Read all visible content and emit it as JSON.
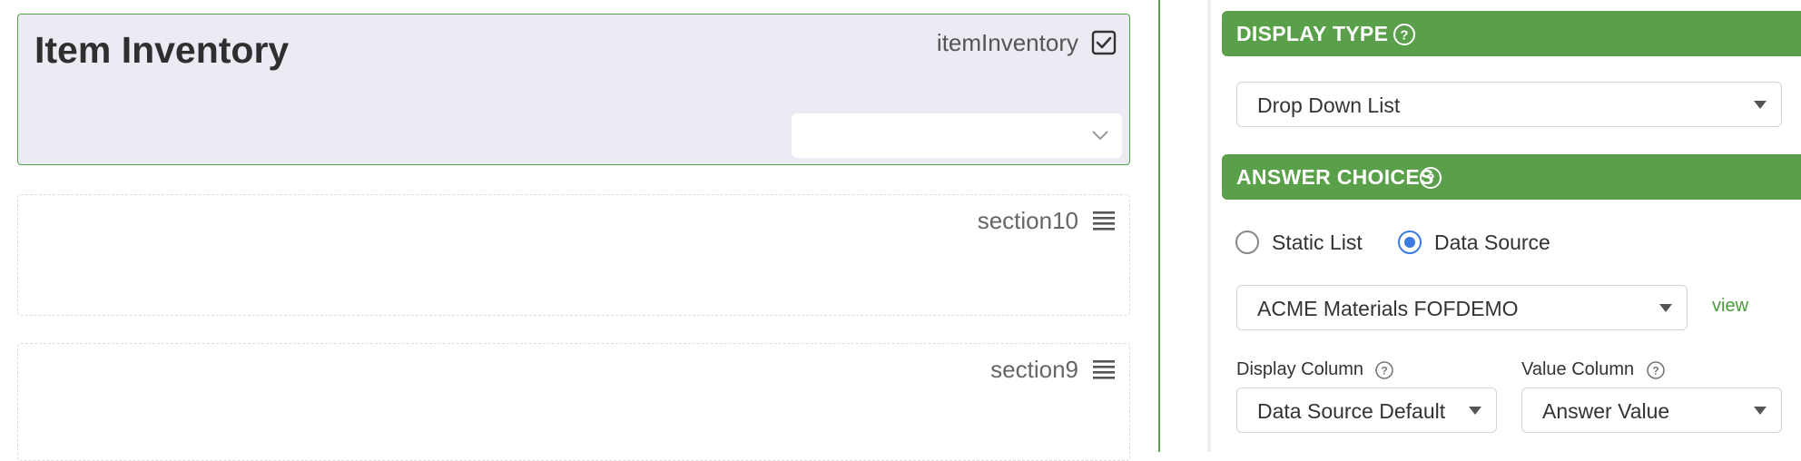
{
  "form": {
    "field": {
      "title": "Item Inventory",
      "id": "itemInventory",
      "select_value": ""
    },
    "sections": [
      {
        "name": "section10"
      },
      {
        "name": "section9"
      }
    ]
  },
  "panel": {
    "display_type": {
      "header": "DISPLAY TYPE",
      "selected": "Drop Down List"
    },
    "answer_choices": {
      "header": "ANSWER CHOICES",
      "options": [
        {
          "label": "Static List",
          "selected": false
        },
        {
          "label": "Data Source",
          "selected": true
        }
      ],
      "data_source": "ACME Materials FOFDEMO",
      "view_link": "view",
      "display_column_label": "Display Column",
      "display_column_value": "Data Source Default",
      "value_column_label": "Value Column",
      "value_column_value": "Answer Value"
    }
  },
  "colors": {
    "accent_green": "#5a9f4a",
    "radio_blue": "#3b7be0",
    "field_bg": "#eaebf3"
  },
  "icons": [
    "checkbox-checked-icon",
    "chevron-down-icon",
    "drag-handle-icon",
    "help-icon",
    "caret-down-icon"
  ]
}
